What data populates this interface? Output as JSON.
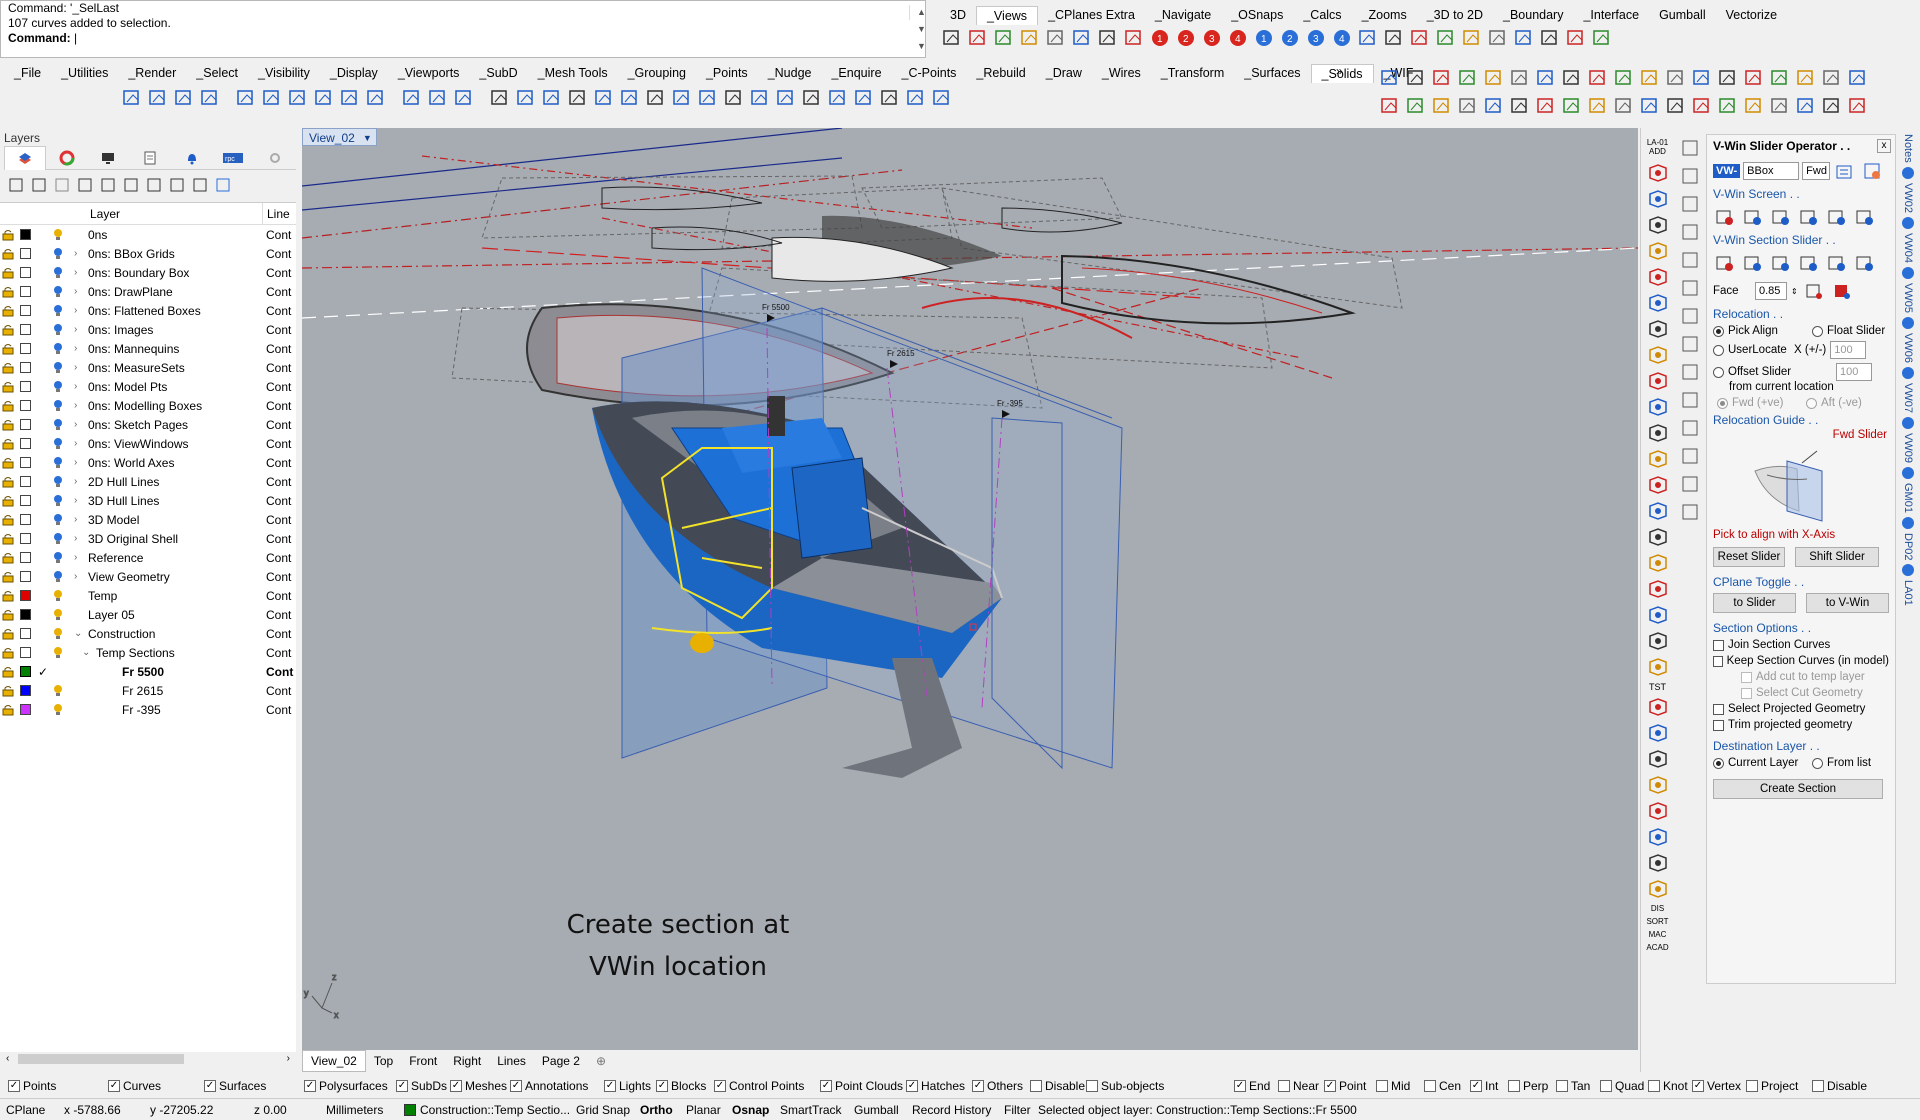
{
  "command": {
    "line1": "Command: '_SelLast",
    "line2": "107 curves added to selection.",
    "prompt": "Command:"
  },
  "top_tabs": [
    "3D",
    "_Views",
    "_CPlanes Extra",
    "_Navigate",
    "_OSnaps",
    "_Calcs",
    "_Zooms",
    "_3D to 2D",
    "_Boundary",
    "_Interface",
    "Gumball",
    "Vectorize"
  ],
  "main_tabs": [
    "_File",
    "_Utilities",
    "_Render",
    "_Select",
    "_Visibility",
    "_Display",
    "_Viewports",
    "_SubD",
    "_Mesh Tools",
    "_Grouping",
    "_Points",
    "_Nudge",
    "_Enquire",
    "_C-Points",
    "_Rebuild",
    "_Draw",
    "_Wires",
    "_Transform",
    "_Surfaces",
    "_Solids",
    "_WIF"
  ],
  "layers": {
    "title": "Layers",
    "col_layer": "Layer",
    "col_linetype": "Line",
    "rows": [
      {
        "name": "0ns",
        "color": "#000000",
        "lt": "Cont",
        "indent": 0,
        "expand": ""
      },
      {
        "name": "0ns: BBox Grids",
        "color": "#ffffff",
        "lt": "Cont",
        "indent": 1,
        "expand": "›"
      },
      {
        "name": "0ns: Boundary Box",
        "color": "#ffffff",
        "lt": "Cont",
        "indent": 1,
        "expand": "›"
      },
      {
        "name": "0ns: DrawPlane",
        "color": "#ffffff",
        "lt": "Cont",
        "indent": 1,
        "expand": "›"
      },
      {
        "name": "0ns: Flattened Boxes",
        "color": "#ffffff",
        "lt": "Cont",
        "indent": 1,
        "expand": "›"
      },
      {
        "name": "0ns: Images",
        "color": "#ffffff",
        "lt": "Cont",
        "indent": 1,
        "expand": "›"
      },
      {
        "name": "0ns: Mannequins",
        "color": "#ffffff",
        "lt": "Cont",
        "indent": 1,
        "expand": "›"
      },
      {
        "name": "0ns: MeasureSets",
        "color": "#ffffff",
        "lt": "Cont",
        "indent": 1,
        "expand": "›"
      },
      {
        "name": "0ns: Model Pts",
        "color": "#ffffff",
        "lt": "Cont",
        "indent": 1,
        "expand": "›"
      },
      {
        "name": "0ns: Modelling Boxes",
        "color": "#ffffff",
        "lt": "Cont",
        "indent": 1,
        "expand": "›"
      },
      {
        "name": "0ns: Sketch Pages",
        "color": "#ffffff",
        "lt": "Cont",
        "indent": 1,
        "expand": "›"
      },
      {
        "name": "0ns: ViewWindows",
        "color": "#ffffff",
        "lt": "Cont",
        "indent": 1,
        "expand": "›"
      },
      {
        "name": "0ns: World Axes",
        "color": "#ffffff",
        "lt": "Cont",
        "indent": 1,
        "expand": "›"
      },
      {
        "name": "2D Hull Lines",
        "color": "#ffffff",
        "lt": "Cont",
        "indent": 1,
        "expand": "›"
      },
      {
        "name": "3D Hull Lines",
        "color": "#ffffff",
        "lt": "Cont",
        "indent": 1,
        "expand": "›"
      },
      {
        "name": "3D Model",
        "color": "#ffffff",
        "lt": "Cont",
        "indent": 1,
        "expand": "›"
      },
      {
        "name": "3D Original Shell",
        "color": "#ffffff",
        "lt": "Cont",
        "indent": 1,
        "expand": "›"
      },
      {
        "name": "Reference",
        "color": "#ffffff",
        "lt": "Cont",
        "indent": 1,
        "expand": "›"
      },
      {
        "name": "View Geometry",
        "color": "#ffffff",
        "lt": "Cont",
        "indent": 1,
        "expand": "›"
      },
      {
        "name": "Temp",
        "color": "#e00000",
        "lt": "Cont",
        "indent": 1,
        "expand": ""
      },
      {
        "name": "Layer 05",
        "color": "#000000",
        "lt": "Cont",
        "indent": 1,
        "expand": ""
      },
      {
        "name": "Construction",
        "color": "#ffffff",
        "lt": "Cont",
        "indent": 1,
        "expand": "⌄"
      },
      {
        "name": "Temp Sections",
        "color": "#ffffff",
        "lt": "Cont",
        "indent": 2,
        "expand": "⌄"
      },
      {
        "name": "Fr 5500",
        "color": "#008000",
        "lt": "Cont",
        "indent": 3,
        "expand": "",
        "current": true
      },
      {
        "name": "Fr 2615",
        "color": "#0000ff",
        "lt": "Cont",
        "indent": 3,
        "expand": ""
      },
      {
        "name": "Fr -395",
        "color": "#cc33ff",
        "lt": "Cont",
        "indent": 3,
        "expand": ""
      }
    ]
  },
  "viewport": {
    "name": "View_02",
    "caption_line1": "Create section at",
    "caption_line2": "VWin location",
    "frame_labels": [
      "Fr 5500",
      "Fr 2615",
      "Fr -395"
    ],
    "tabs": [
      "View_02",
      "Top",
      "Front",
      "Right",
      "Lines",
      "Page 2"
    ]
  },
  "strip_labels": {
    "top": "LA-01 ADD",
    "tst": "TST",
    "dis": "DIS",
    "sort": "SORT",
    "mac": "MAC",
    "acad": "ACAD"
  },
  "panel": {
    "title": "V-Win Slider Operator . .",
    "close": "x",
    "vw_label": "VW-",
    "bbox_value": "BBox",
    "fwd_value": "Fwd",
    "vwin_screen": "V-Win Screen . .",
    "vwin_section_slider": "V-Win Section Slider . .",
    "face_label": "Face",
    "face_value": "0.85",
    "relocation": "Relocation . .",
    "pick_align": "Pick Align",
    "float_slider": "Float Slider",
    "user_locate": "UserLocate",
    "x_label": "X (+/-)",
    "x_value": "100",
    "offset_slider": "Offset Slider",
    "offset_value": "100",
    "from_current": "from current location",
    "fwd_ve": "Fwd (+ve)",
    "aft_ve": "Aft (-ve)",
    "relocation_guide": "Relocation Guide . .",
    "fwd_slider": "Fwd Slider",
    "pick_hint": "Pick to align with X-Axis",
    "reset_slider": "Reset Slider",
    "shift_slider": "Shift Slider",
    "cplane_toggle": "CPlane Toggle . .",
    "to_slider": "to Slider",
    "to_vwin": "to V-Win",
    "section_options": "Section Options . .",
    "join_curves": "Join Section Curves",
    "keep_curves": "Keep Section Curves (in model)",
    "add_cut": "Add cut to temp layer",
    "select_cut": "Select Cut Geometry",
    "select_projected": "Select Projected Geometry",
    "trim_projected": "Trim projected geometry",
    "destination_layer": "Destination Layer . .",
    "current_layer": "Current Layer",
    "from_list": "From list",
    "create_section": "Create Section"
  },
  "sidebar_tabs": [
    "Notes",
    "VW02",
    "VW04",
    "VW05",
    "VW06",
    "VW07",
    "VW09",
    "GM01",
    "DP02",
    "LA01"
  ],
  "filters": {
    "left": [
      {
        "label": "Points",
        "checked": true
      },
      {
        "label": "Curves",
        "checked": true
      },
      {
        "label": "Surfaces",
        "checked": true
      },
      {
        "label": "Polysurfaces",
        "checked": true
      },
      {
        "label": "SubDs",
        "checked": true
      },
      {
        "label": "Meshes",
        "checked": true
      },
      {
        "label": "Annotations",
        "checked": true
      },
      {
        "label": "Lights",
        "checked": true
      },
      {
        "label": "Blocks",
        "checked": true
      },
      {
        "label": "Control Points",
        "checked": true
      },
      {
        "label": "Point Clouds",
        "checked": true
      },
      {
        "label": "Hatches",
        "checked": true
      },
      {
        "label": "Others",
        "checked": true
      },
      {
        "label": "Disable",
        "checked": false
      },
      {
        "label": "Sub-objects",
        "checked": false
      }
    ],
    "right": [
      {
        "label": "End",
        "checked": true
      },
      {
        "label": "Near",
        "checked": false
      },
      {
        "label": "Point",
        "checked": true
      },
      {
        "label": "Mid",
        "checked": false
      },
      {
        "label": "Cen",
        "checked": false
      },
      {
        "label": "Int",
        "checked": true
      },
      {
        "label": "Perp",
        "checked": false
      },
      {
        "label": "Tan",
        "checked": false
      },
      {
        "label": "Quad",
        "checked": false
      },
      {
        "label": "Knot",
        "checked": false
      },
      {
        "label": "Vertex",
        "checked": true
      },
      {
        "label": "Project",
        "checked": false
      },
      {
        "label": "Disable",
        "checked": false
      }
    ]
  },
  "status": {
    "cplane": "CPlane",
    "x": "x -5788.66",
    "y": "y -27205.22",
    "z": "z 0.00",
    "units": "Millimeters",
    "layer": "Construction::Temp Sectio...",
    "layer_color": "#008000",
    "grid_snap": "Grid Snap",
    "ortho": "Ortho",
    "planar": "Planar",
    "osnap": "Osnap",
    "smarttrack": "SmartTrack",
    "gumball": "Gumball",
    "record_history": "Record History",
    "filter": "Filter",
    "message": "Selected object layer: Construction::Temp Sections::Fr 5500"
  }
}
